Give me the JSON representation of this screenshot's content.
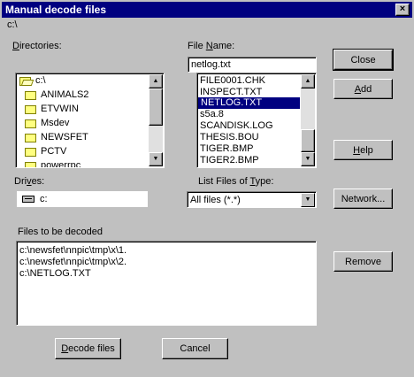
{
  "window": {
    "title": "Manual decode files",
    "close_glyph": "×",
    "current_path": "c:\\"
  },
  "directories": {
    "label_pre": "",
    "label_u": "D",
    "label_post": "irectories:",
    "items": [
      "c:\\",
      "ANIMALS2",
      "ETVWIN",
      "Msdev",
      "NEWSFET",
      "PCTV",
      "powerrpc"
    ]
  },
  "file_name": {
    "label_pre": "File ",
    "label_u": "N",
    "label_post": "ame:",
    "value": "netlog.txt",
    "items": [
      "FILE0001.CHK",
      "INSPECT.TXT",
      "NETLOG.TXT",
      "s5a.8",
      "SCANDISK.LOG",
      "THESIS.BOU",
      "TIGER.BMP",
      "TIGER2.BMP"
    ],
    "selected_index": 2
  },
  "drives": {
    "label_pre": "Dri",
    "label_u": "v",
    "label_post": "es:",
    "value": "c:"
  },
  "list_type": {
    "label_pre": "List Files of ",
    "label_u": "T",
    "label_post": "ype:",
    "value": "All files (*.*)"
  },
  "files_to_decode": {
    "label": "Files to be decoded",
    "items": [
      "c:\\newsfet\\nnpic\\tmp\\x\\1.",
      "c:\\newsfet\\nnpic\\tmp\\x\\2.",
      "c:\\NETLOG.TXT"
    ]
  },
  "buttons": {
    "close": "Close",
    "add_pre": "",
    "add_u": "A",
    "add_post": "dd",
    "help_pre": "",
    "help_u": "H",
    "help_post": "elp",
    "network": "Network...",
    "remove": "Remove",
    "decode_pre": "",
    "decode_u": "D",
    "decode_post": "ecode files",
    "cancel": "Cancel"
  },
  "icons": {
    "folder": "folder-icon",
    "open_folder": "open-folder-icon",
    "drive": "drive-icon",
    "up_arrow": "▲",
    "down_arrow": "▼"
  },
  "colors": {
    "title_bar": "#000080",
    "selection": "#000080",
    "face": "#c0c0c0"
  }
}
